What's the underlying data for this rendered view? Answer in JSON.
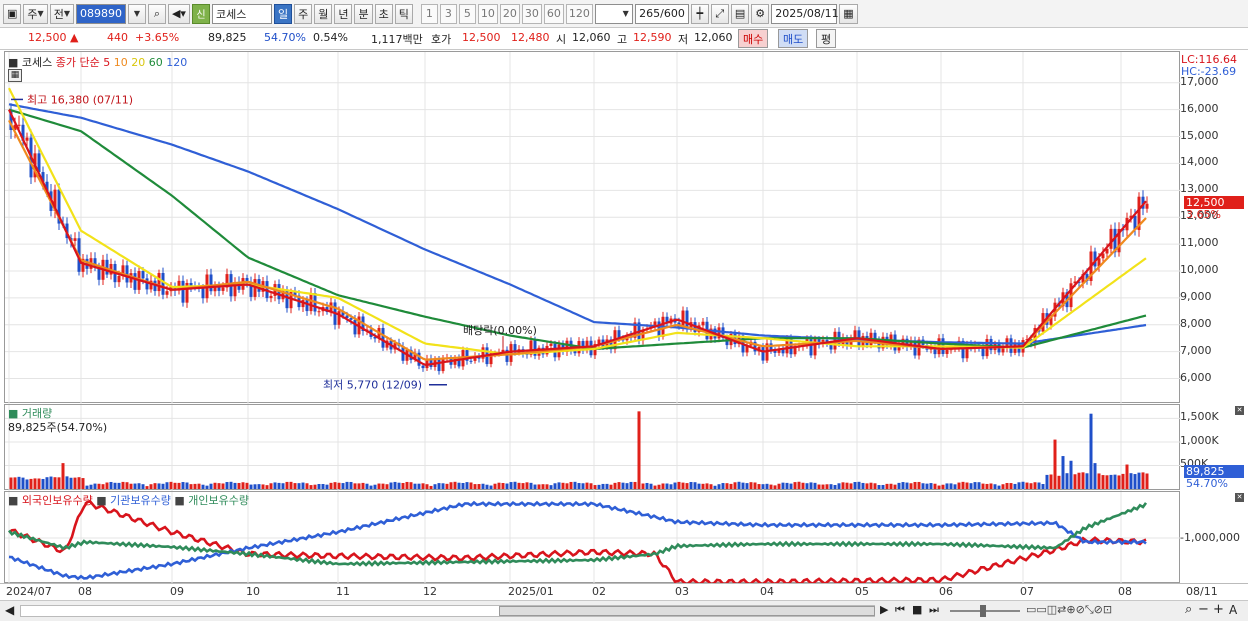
{
  "toolbar": {
    "period_select": "주",
    "mode_select": "전",
    "stock_code": "089890",
    "market_badge": "신",
    "stock_name": "코세스",
    "period_tabs": [
      "일",
      "주",
      "월",
      "년",
      "분",
      "초",
      "틱"
    ],
    "active_period": "일",
    "interval_buttons": [
      "1",
      "3",
      "5",
      "10",
      "20",
      "30",
      "60",
      "120"
    ],
    "count_value": "265",
    "count_total": "/600",
    "date_value": "2025/08/11"
  },
  "quote": {
    "price": "12,500",
    "change": "440",
    "change_pct": "+3.65%",
    "volume": "89,825",
    "volume_ratio": "54.70%",
    "turnover": "0.54%",
    "amount": "1,117백만",
    "bid_label": "호가",
    "ask": "12,500",
    "bid": "12,480",
    "open_label": "시",
    "open": "12,060",
    "high_label": "고",
    "high": "12,590",
    "low_label": "저",
    "low": "12,060",
    "buy_button": "매수",
    "sell_button": "매도",
    "eval_button": "평"
  },
  "price_panel": {
    "legend_name": "코세스",
    "legend_ma": "종가 단순",
    "ma_periods": [
      "5",
      "10",
      "20",
      "60",
      "120"
    ],
    "ma_colors": [
      "#d8141c",
      "#ef8a1e",
      "#f2e21a",
      "#1f8b3a",
      "#2f5fd6"
    ],
    "lc_label": "LC:116.64",
    "hc_label": "HC:-23.69",
    "high_annotation": "최고 16,380 (07/11)",
    "low_annotation": "최저 5,770 (12/09)",
    "dividend_annotation": "배당락(0.00%)",
    "current_price_tag": "12,500",
    "current_pct_tag": "3.65%",
    "y_ticks": [
      "17,000",
      "16,000",
      "15,000",
      "14,000",
      "13,000",
      "12,000",
      "11,000",
      "10,000",
      "9,000",
      "8,000",
      "7,000",
      "6,000"
    ]
  },
  "volume_panel": {
    "title": "거래량",
    "value": "89,825주(54.70%)",
    "y_ticks": [
      "1,500K",
      "1,000K",
      "500K"
    ],
    "tag_value": "89,825",
    "tag_pct": "54.70%"
  },
  "holdings_panel": {
    "legend": [
      "외국인보유수량",
      "기관보유수량",
      "개인보유수량"
    ],
    "colors": [
      "#d8141c",
      "#2f5fd6",
      "#2f8b5a"
    ],
    "y_tick": "-1,000,000"
  },
  "x_axis": {
    "labels": [
      "2024/07",
      "08",
      "09",
      "10",
      "11",
      "12",
      "2025/01",
      "02",
      "03",
      "04",
      "05",
      "06",
      "07",
      "08",
      "08/11"
    ]
  },
  "chart_data": {
    "type": "line",
    "title": "",
    "x": [
      "2024/07",
      "08",
      "09",
      "10",
      "11",
      "12",
      "2025/01",
      "02",
      "03",
      "04",
      "05",
      "06",
      "07",
      "08"
    ],
    "ylim": [
      5500,
      17400
    ],
    "series": [
      {
        "name": "5",
        "values": [
          16000,
          10300,
          9300,
          9500,
          8400,
          6500,
          7000,
          7200,
          8200,
          7000,
          7500,
          7100,
          7200,
          11500
        ]
      },
      {
        "name": "10",
        "values": [
          15600,
          10400,
          9300,
          9600,
          8600,
          6700,
          6900,
          7200,
          8000,
          7200,
          7400,
          7100,
          7200,
          11000
        ]
      },
      {
        "name": "20",
        "values": [
          16800,
          11500,
          9400,
          9500,
          9000,
          7300,
          6900,
          7100,
          7700,
          7500,
          7200,
          7200,
          7150,
          9800
        ]
      },
      {
        "name": "60",
        "values": [
          16000,
          15200,
          12800,
          10500,
          9100,
          8300,
          7600,
          7100,
          7300,
          7500,
          7500,
          7300,
          7150,
          8100
        ]
      },
      {
        "name": "120",
        "values": [
          16200,
          15700,
          14700,
          13700,
          12300,
          10800,
          9500,
          8100,
          7900,
          7600,
          7450,
          7350,
          7300,
          7850
        ]
      }
    ],
    "current_price": 12500,
    "period_high": 16380,
    "period_low": 5770
  }
}
